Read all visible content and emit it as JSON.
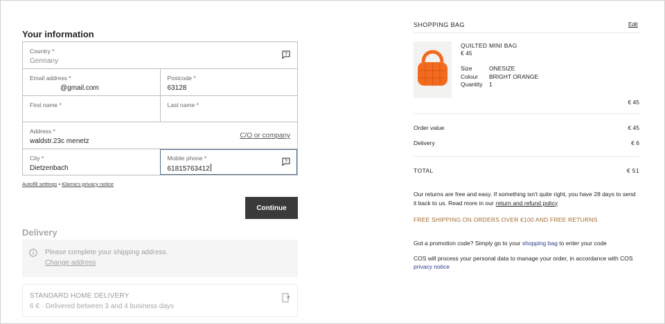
{
  "your_info": {
    "title": "Your information",
    "country_label": "Country *",
    "country_value": "Germany",
    "email_label": "Email address *",
    "email_value": "@gmail.com",
    "postcode_label": "Postcode *",
    "postcode_value": "63128",
    "first_name_label": "First name *",
    "first_name_value": "",
    "last_name_label": "Last name *",
    "last_name_value": "",
    "address_label": "Address *",
    "address_value": "waldstr.23c menetz",
    "co_company_link": "C/O or company",
    "city_label": "City *",
    "city_value": "Dietzenbach",
    "mobile_label": "Mobile phone *",
    "mobile_value": "61815763412",
    "autofill_link": "Autofill settings",
    "separator": " • ",
    "privacy_link": "Klarna's privacy notice",
    "continue_label": "Continue"
  },
  "delivery": {
    "title": "Delivery",
    "note": "Please complete your shipping address.",
    "change_address": "Change address",
    "option_name": "STANDARD HOME DELIVERY",
    "option_desc": "6 € · Delivered between 3 and 4 business days"
  },
  "bag": {
    "title": "SHOPPING BAG",
    "edit": "Edit",
    "product": {
      "name": "QUILTED MINI BAG",
      "price": "€ 45",
      "size_label": "Size",
      "size_value": "ONESIZE",
      "colour_label": "Colour",
      "colour_value": "BRIGHT ORANGE",
      "quantity_label": "Quantity",
      "quantity_value": "1",
      "line_total": "€ 45",
      "color_hex": "#f26a1d"
    },
    "order_value_label": "Order value",
    "order_value": "€ 45",
    "delivery_label": "Delivery",
    "delivery_value": "€ 6",
    "total_label": "TOTAL",
    "total_value": "€ 51",
    "returns_text": "Our returns are free and easy. If something isn't quite right, you have 28 days to send it back to us. Read more in our",
    "returns_link": "return and refund policy",
    "free_shipping": "FREE SHIPPING ON ORDERS OVER €100 AND FREE RETURNS",
    "promo_prefix": "Got a promotion code? Simply go to your ",
    "promo_link": "shopping bag",
    "promo_suffix": " to enter your code",
    "privacy_prefix": "COS will process your personal data to manage your order, in accordance with COS ",
    "privacy_link": "privacy notice"
  }
}
